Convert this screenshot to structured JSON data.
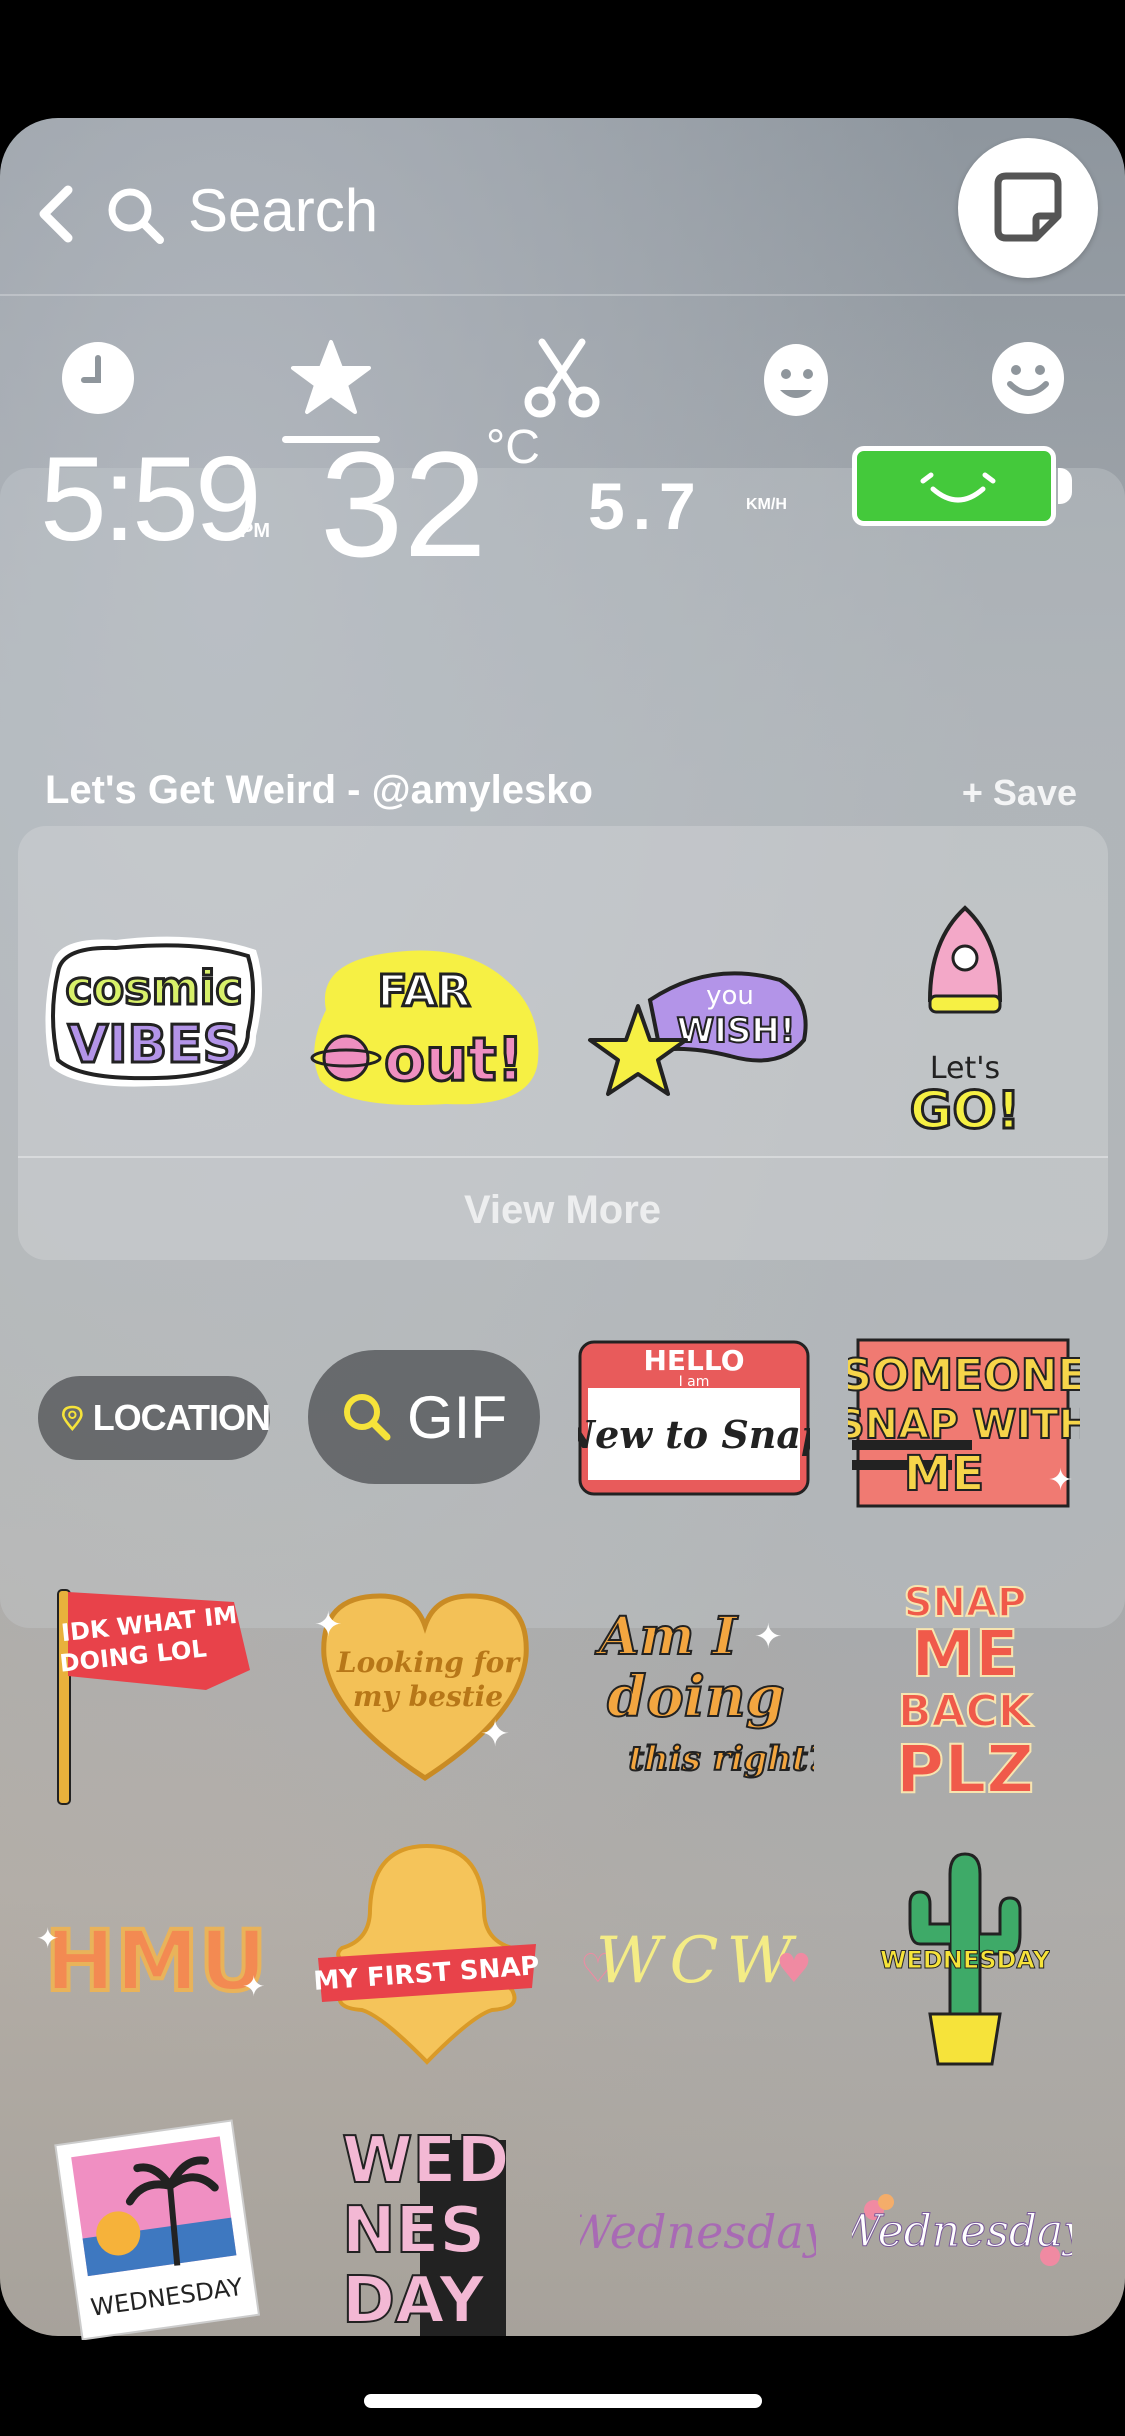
{
  "header": {
    "search_label": "Search"
  },
  "tabs": [
    {
      "name": "recents",
      "icon": "clock-icon"
    },
    {
      "name": "favorites",
      "icon": "star-icon",
      "active": true
    },
    {
      "name": "cutouts",
      "icon": "scissors-icon"
    },
    {
      "name": "bitmoji",
      "icon": "bitmoji-face-icon"
    },
    {
      "name": "emoji",
      "icon": "smiley-icon"
    }
  ],
  "widgets": {
    "time": "5:59",
    "time_period": "PM",
    "temperature": "32",
    "temperature_unit": "°C",
    "speed": "5.7",
    "speed_unit": "KM/H",
    "battery_color": "#44c93b"
  },
  "pack": {
    "title": "Let's Get Weird - @amylesko",
    "save_label": "+ Save",
    "view_more_label": "View More",
    "stickers": [
      {
        "name": "cosmic-vibes",
        "text": [
          "cosmic",
          "VIBES"
        ]
      },
      {
        "name": "far-out",
        "text": [
          "FAR",
          "out!"
        ]
      },
      {
        "name": "you-wish",
        "text": [
          "you",
          "WISH!"
        ]
      },
      {
        "name": "lets-go",
        "text": [
          "Let's",
          "GO!"
        ]
      }
    ]
  },
  "chips": {
    "location_label": "LOCATION",
    "gif_label": "GIF"
  },
  "stickers": {
    "hello_top": "HELLO",
    "hello_sub": "I am",
    "hello_body": "New to Snap",
    "someone_snap": [
      "SOMEONE",
      "SNAP WITH",
      "ME"
    ],
    "idk": [
      "IDK WHAT IM",
      "DOING LOL"
    ],
    "looking_for": [
      "Looking for",
      "my bestie"
    ],
    "am_i_doing": [
      "Am I",
      "doing",
      "this right?"
    ],
    "snap_me_back": [
      "SNAP",
      "ME",
      "BACK",
      "PLZ"
    ],
    "hmu": "HMU",
    "my_first_snap": "MY FIRST SNAP",
    "wcw": "WCW",
    "wednesday_cactus": "WEDNESDAY",
    "wednesday_photo": "WEDNESDAY",
    "wed_nes_day": [
      "WED",
      "NES",
      "DAY"
    ],
    "wednesday_script_1": "Wednesday",
    "wednesday_script_2": "Wednesday"
  }
}
